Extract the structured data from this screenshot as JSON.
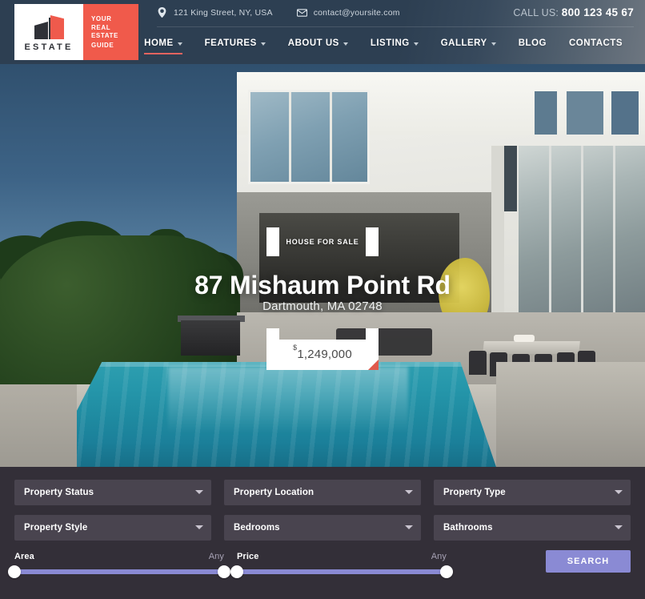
{
  "header": {
    "logo": {
      "brand": "ESTATE",
      "tagline_lines": [
        "YOUR",
        "REAL ESTATE",
        "GUIDE"
      ],
      "brand_color": "#f05a4b",
      "mark": "building-logo-icon"
    },
    "contact": {
      "address": "121 King Street, NY, USA",
      "address_icon": "location-pin-icon",
      "email": "contact@yoursite.com",
      "email_icon": "envelope-icon",
      "call_label": "CALL US:",
      "phone": "800 123 45 67"
    },
    "nav": [
      {
        "label": "HOME",
        "has_dropdown": true,
        "active": true
      },
      {
        "label": "FEATURES",
        "has_dropdown": true,
        "active": false
      },
      {
        "label": "ABOUT US",
        "has_dropdown": true,
        "active": false
      },
      {
        "label": "LISTING",
        "has_dropdown": true,
        "active": false
      },
      {
        "label": "GALLERY",
        "has_dropdown": true,
        "active": false
      },
      {
        "label": "BLOG",
        "has_dropdown": false,
        "active": false
      },
      {
        "label": "CONTACTS",
        "has_dropdown": false,
        "active": false
      }
    ],
    "accent_color": "#e2645f",
    "background_color": "#2d3f52"
  },
  "hero": {
    "badge": "HOUSE FOR SALE",
    "title": "87 Mishaum Point Rd",
    "subtitle": "Dartmouth, MA 02748",
    "price_currency": "$",
    "price_value": "1,249,000"
  },
  "filters": {
    "selects": [
      {
        "label": "Property Status",
        "icon": "chevron-down-icon"
      },
      {
        "label": "Property Location",
        "icon": "chevron-down-icon"
      },
      {
        "label": "Property Type",
        "icon": "chevron-down-icon"
      },
      {
        "label": "Property Style",
        "icon": "chevron-down-icon"
      },
      {
        "label": "Bedrooms",
        "icon": "chevron-down-icon"
      },
      {
        "label": "Bathrooms",
        "icon": "chevron-down-icon"
      }
    ],
    "sliders": [
      {
        "label": "Area",
        "value": "Any",
        "min_pct": 0,
        "max_pct": 100
      },
      {
        "label": "Price",
        "value": "Any",
        "min_pct": 0,
        "max_pct": 100
      }
    ],
    "search_label": "SEARCH",
    "accent_color": "#8a8ad4",
    "background_color": "#332f38"
  }
}
